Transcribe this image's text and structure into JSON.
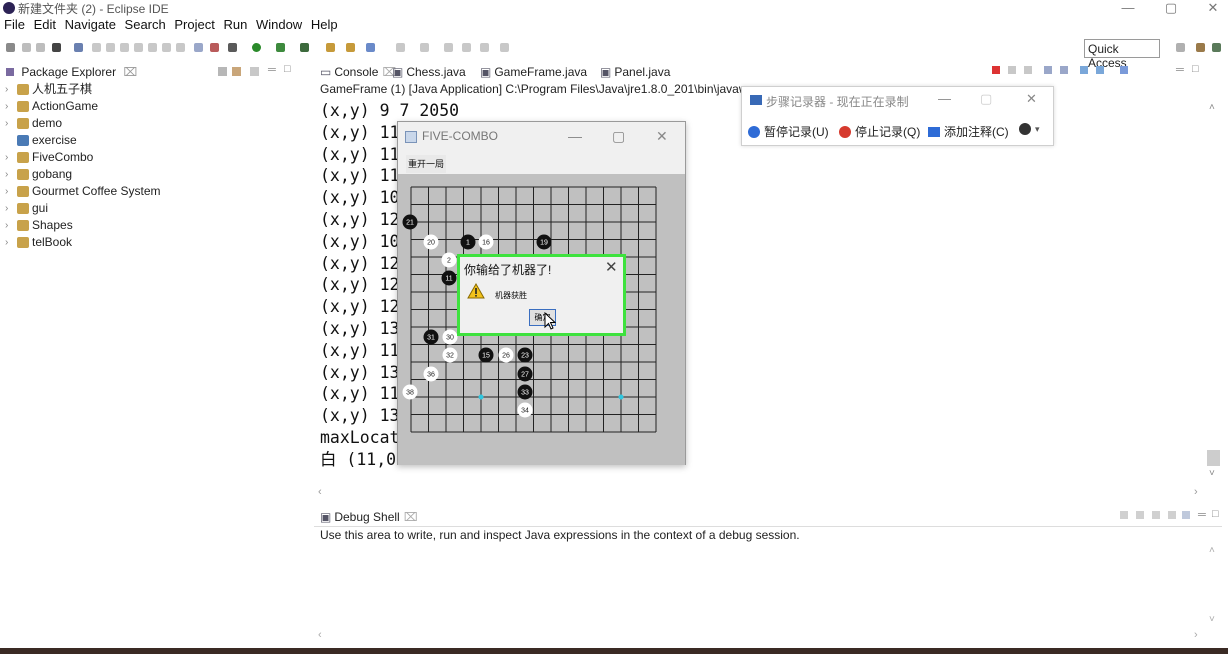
{
  "window": {
    "title": "新建文件夹 (2) - Eclipse IDE",
    "min": "—",
    "max": "▢",
    "close": "✕"
  },
  "menu": [
    "File",
    "Edit",
    "Navigate",
    "Search",
    "Project",
    "Run",
    "Window",
    "Help"
  ],
  "toolbar": {
    "quick_access": "Quick Access"
  },
  "package_explorer": {
    "title": "Package Explorer",
    "projects": [
      "人机五子棋",
      "ActionGame",
      "demo",
      "exercise",
      "FiveCombo",
      "gobang",
      "Gourmet Coffee System",
      "gui",
      "Shapes",
      "telBook"
    ]
  },
  "editor_tabs": [
    "Console",
    "Chess.java",
    "GameFrame.java",
    "Panel.java"
  ],
  "console": {
    "status": "GameFrame (1) [Java Application] C:\\Program Files\\Java\\jre1.8.0_201\\bin\\javaw",
    "lines": [
      "(x,y) 9 7 2050",
      "(x,y) 11",
      "(x,y) 11",
      "(x,y) 11",
      "(x,y) 10",
      "(x,y) 12",
      "(x,y) 10",
      "(x,y) 12",
      "(x,y) 12",
      "(x,y) 12",
      "(x,y) 13",
      "(x,y) 11",
      "(x,y) 13",
      "(x,y) 11",
      "(x,y) 13",
      "maxLocat",
      "白 (11,0"
    ]
  },
  "debug_shell": {
    "title": "Debug Shell",
    "hint": "Use this area to write, run and inspect Java expressions in the context of a debug session."
  },
  "steps_recorder": {
    "title": "步骤记录器 - 现在正在录制",
    "pause": "暂停记录(U)",
    "stop": "停止记录(Q)",
    "comment": "添加注释(C)"
  },
  "game": {
    "title": "FIVE-COMBO",
    "restart": "重开一局",
    "stones": [
      {
        "label": "21",
        "color": "black"
      },
      {
        "label": "20",
        "color": "white"
      },
      {
        "label": "1",
        "color": "black"
      },
      {
        "label": "16",
        "color": "white"
      },
      {
        "label": "19",
        "color": "black"
      },
      {
        "label": "2",
        "color": "white"
      },
      {
        "label": "11",
        "color": "black"
      },
      {
        "label": "31",
        "color": "black"
      },
      {
        "label": "30",
        "color": "white"
      },
      {
        "label": "32",
        "color": "white"
      },
      {
        "label": "15",
        "color": "black"
      },
      {
        "label": "26",
        "color": "white"
      },
      {
        "label": "23",
        "color": "black"
      },
      {
        "label": "36",
        "color": "white"
      },
      {
        "label": "27",
        "color": "black"
      },
      {
        "label": "38",
        "color": "white"
      },
      {
        "label": "33",
        "color": "black"
      },
      {
        "label": "34",
        "color": "white"
      }
    ]
  },
  "dialog": {
    "title": "你输给了机器了!",
    "message": "机器获胜",
    "ok": "确定",
    "close": "✕"
  }
}
